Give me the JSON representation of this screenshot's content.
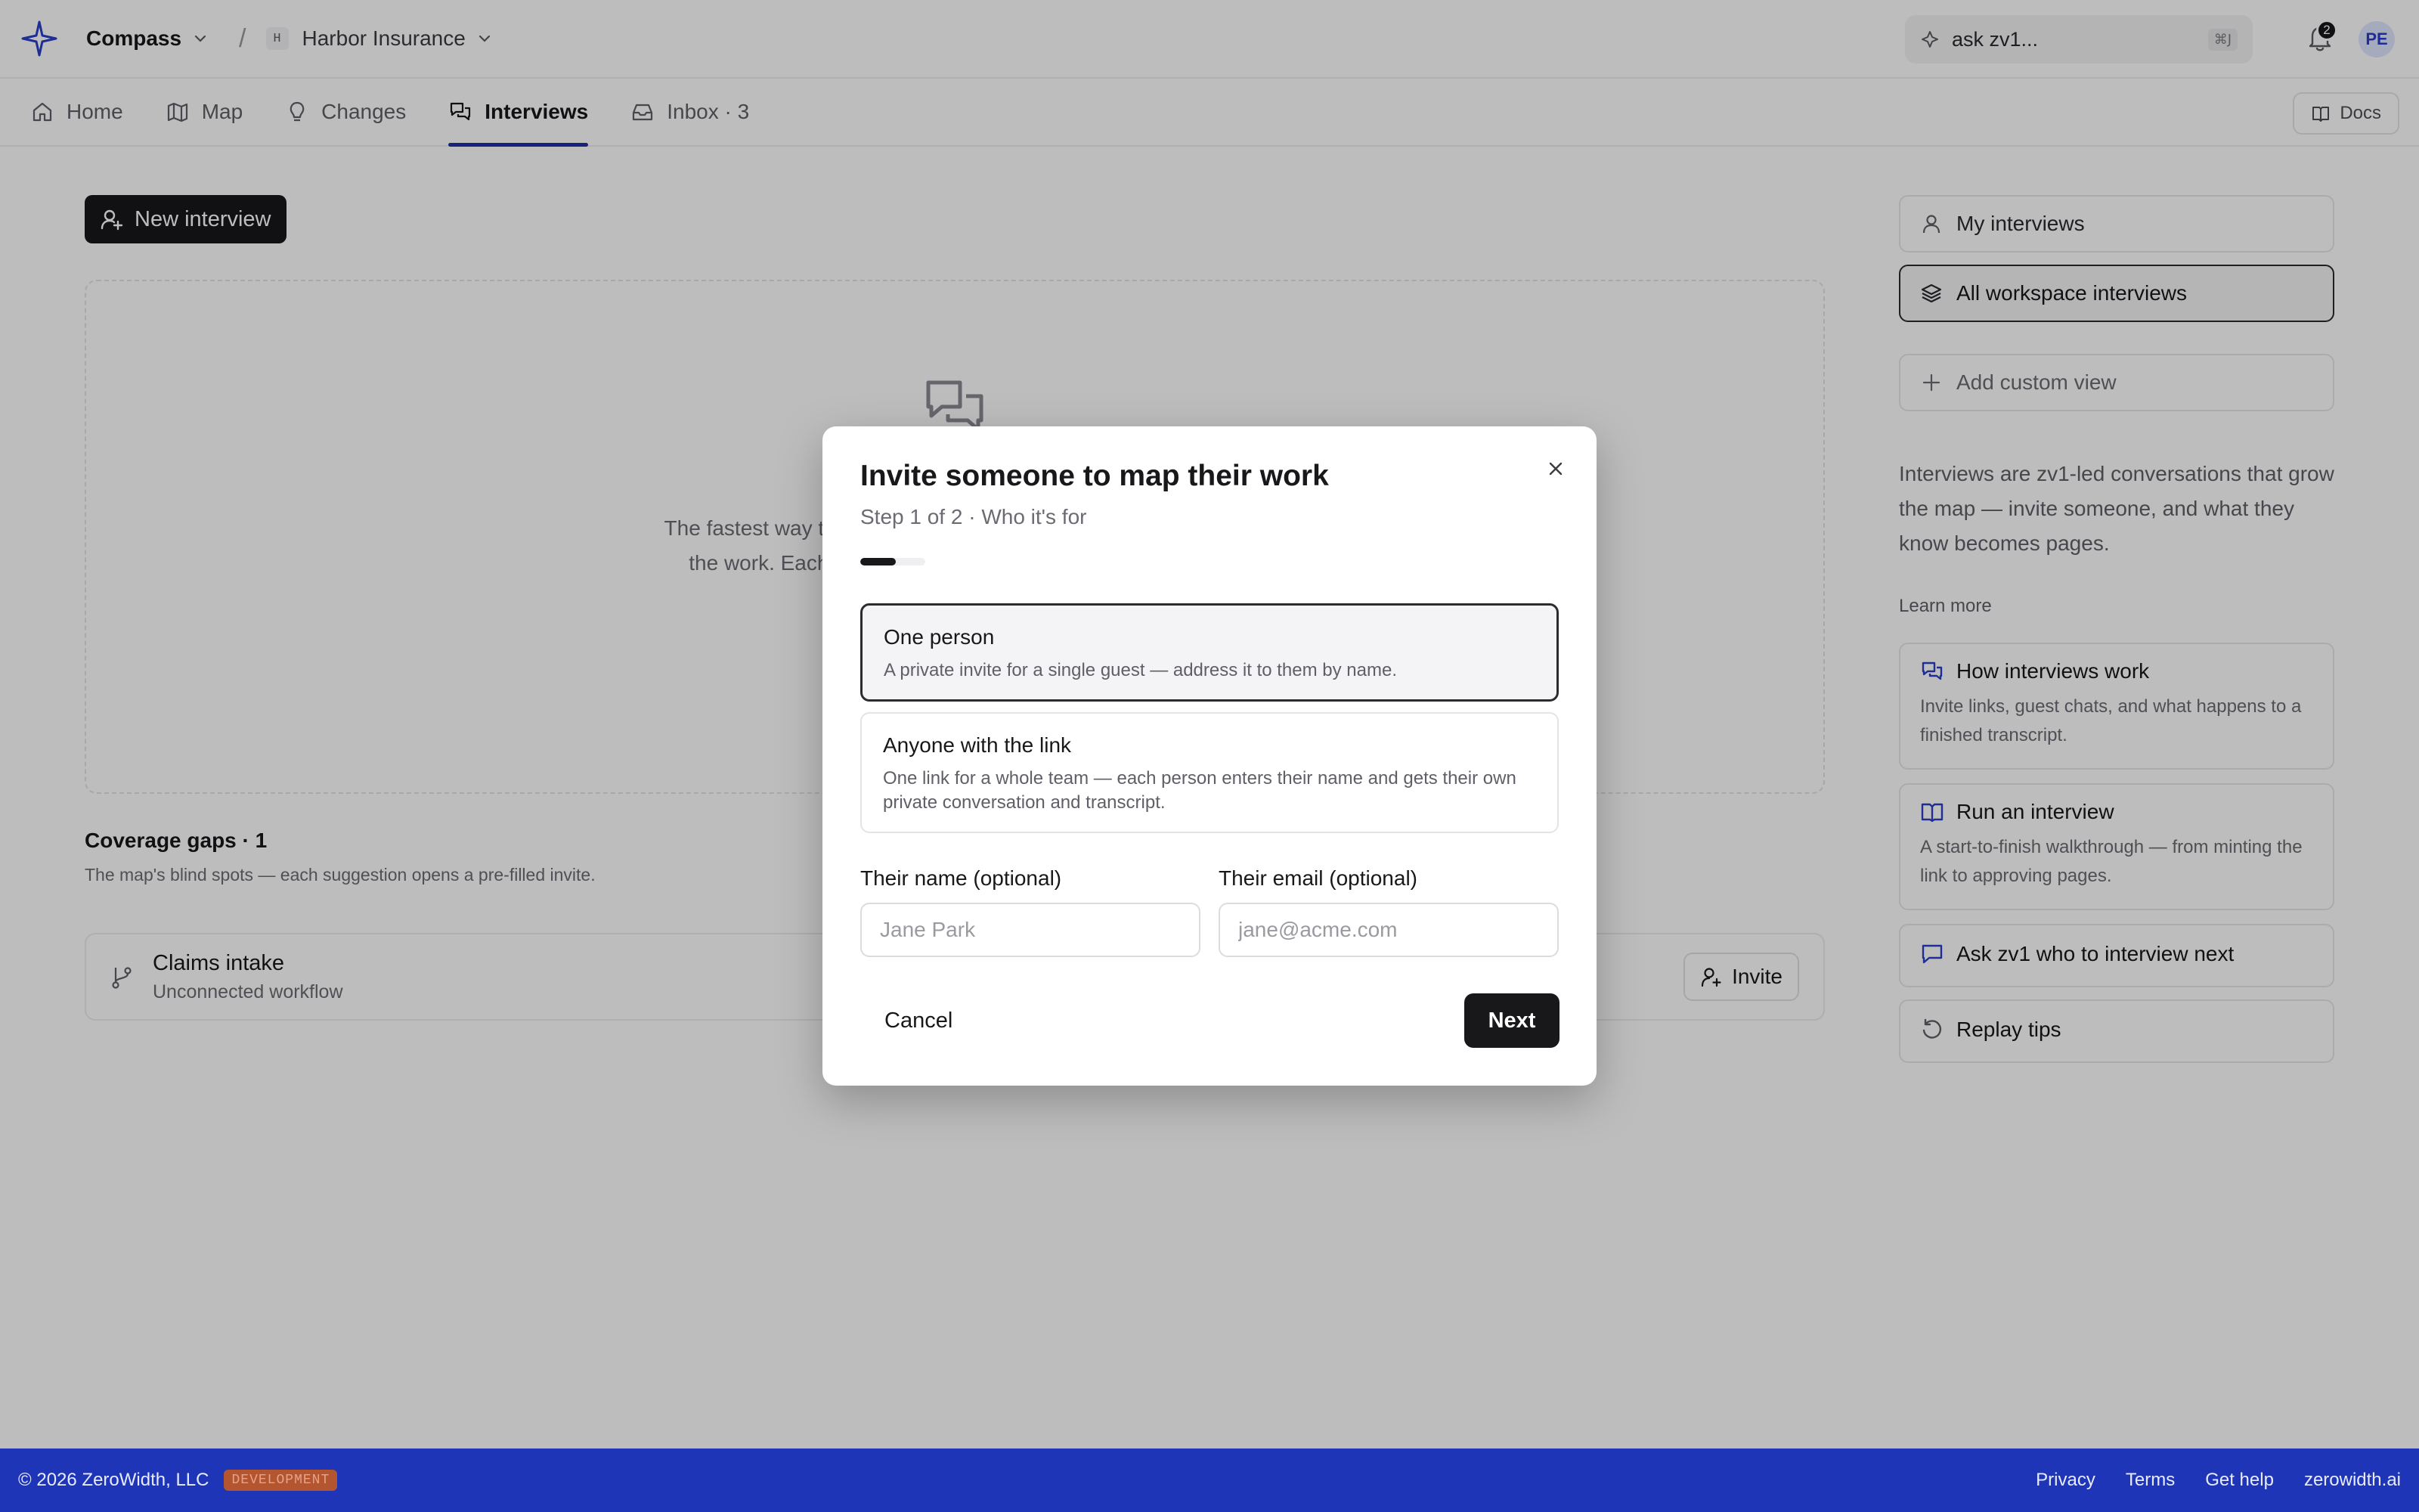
{
  "header": {
    "app_name": "Compass",
    "separator": "/",
    "workspace_initial": "H",
    "workspace_name": "Harbor Insurance",
    "search_placeholder": "ask zv1...",
    "search_shortcut": "⌘J",
    "notification_count": "2",
    "avatar_initials": "PE"
  },
  "tabs": [
    {
      "label": "Home",
      "icon": "home-icon"
    },
    {
      "label": "Map",
      "icon": "map-icon"
    },
    {
      "label": "Changes",
      "icon": "lightbulb-icon"
    },
    {
      "label": "Interviews",
      "icon": "chat-bubbles-icon",
      "active": true
    },
    {
      "label": "Inbox · 3",
      "icon": "inbox-icon"
    }
  ],
  "docs_label": "Docs",
  "main": {
    "new_interview_label": "New interview",
    "empty_text": "The fastest way to grow the map is to talk to the people who do the work. Each interview becomes pages and a transcript.",
    "coverage_title": "Coverage gaps · 1",
    "coverage_subtitle": "The map's blind spots — each suggestion opens a pre-filled invite.",
    "gaps": [
      {
        "title": "Claims intake",
        "subtitle": "Unconnected workflow",
        "action": "Invite"
      }
    ]
  },
  "rail": {
    "views": [
      {
        "label": "My interviews",
        "icon": "person-icon"
      },
      {
        "label": "All workspace interviews",
        "icon": "layers-icon",
        "selected": true
      },
      {
        "label": "Add custom view",
        "icon": "plus-icon"
      }
    ],
    "blurb": "Interviews are zv1-led conversations that grow the map — invite someone, and what they know becomes pages.",
    "learn_more_label": "Learn more",
    "cards": [
      {
        "title": "How interviews work",
        "body": "Invite links, guest chats, and what happens to a finished transcript.",
        "icon": "chat-bubbles-icon"
      },
      {
        "title": "Run an interview",
        "body": "A start-to-finish walkthrough — from minting the link to approving pages.",
        "icon": "book-icon"
      },
      {
        "title": "Ask zv1 who to interview next",
        "icon": "chat-icon"
      },
      {
        "title": "Replay tips",
        "icon": "replay-icon"
      }
    ]
  },
  "footer": {
    "copyright": "© 2026 ZeroWidth, LLC",
    "env_badge": "DEVELOPMENT",
    "links": [
      "Privacy",
      "Terms",
      "Get help",
      "zerowidth.ai"
    ]
  },
  "modal": {
    "title": "Invite someone to map their work",
    "step": "Step 1 of 2 · Who it's for",
    "progress_fraction": 0.55,
    "options": [
      {
        "title": "One person",
        "desc": "A private invite for a single guest — address it to them by name.",
        "selected": true
      },
      {
        "title": "Anyone with the link",
        "desc": "One link for a whole team — each person enters their name and gets their own private conversation and transcript.",
        "selected": false
      }
    ],
    "name_label": "Their name (optional)",
    "name_placeholder": "Jane Park",
    "email_label": "Their email (optional)",
    "email_placeholder": "jane@acme.com",
    "cancel_label": "Cancel",
    "next_label": "Next"
  },
  "colors": {
    "accent": "#1e2fa8",
    "footer_bg": "#1e35b8",
    "primary_button": "#18181b",
    "env_badge": "#b3562f"
  }
}
